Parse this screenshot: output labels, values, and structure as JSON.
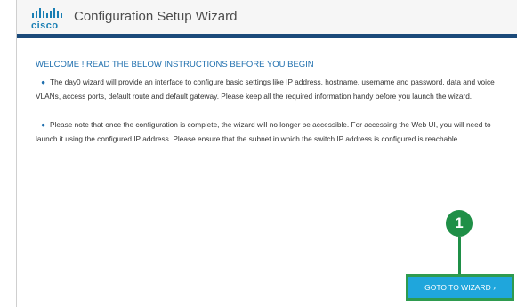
{
  "header": {
    "logo_text": "cisco",
    "title": "Configuration Setup Wizard"
  },
  "main": {
    "welcome": "WELCOME ! READ THE BELOW INSTRUCTIONS BEFORE YOU BEGIN",
    "paragraphs": [
      "The day0 wizard will provide an interface to configure basic settings like IP address, hostname, username and password, data and voice VLANs, access ports, default route and default gateway. Please keep all the required information handy before you launch the wizard.",
      "Please note that once the configuration is complete, the wizard will no longer be accessible. For accessing the Web UI, you will need to launch it using the configured IP address. Please ensure that the subnet in which the switch IP address is configured is reachable."
    ]
  },
  "callout": {
    "number": "1"
  },
  "footer": {
    "goto_label": "GOTO TO WIZARD ›"
  },
  "colors": {
    "accent": "#1fa6dc",
    "header_bar": "#1b4a7a",
    "callout": "#1f8f47",
    "brand": "#1a7fb4"
  }
}
